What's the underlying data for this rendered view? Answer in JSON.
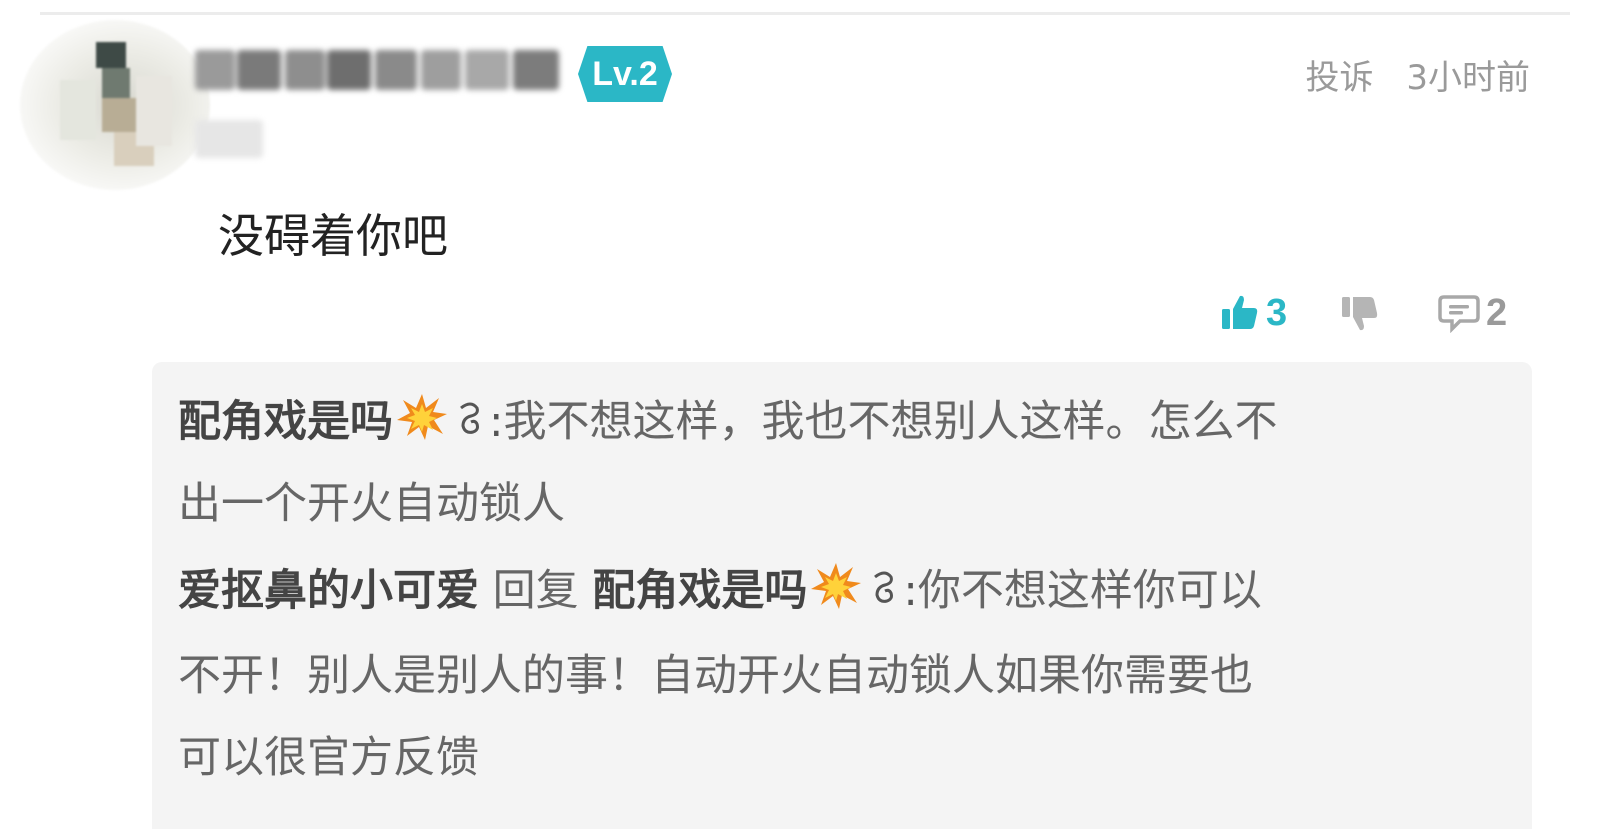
{
  "comment": {
    "level_badge": "Lv.2",
    "report_label": "投诉",
    "time": "3小时前",
    "text": "没碍着你吧",
    "likes": "3",
    "replies_count": "2",
    "accent_color": "#2bb7c6"
  },
  "replies": {
    "r1": {
      "nick": "配角戏是吗",
      "sep": ":",
      "line1": "我不想这样，我也不想别人这样。怎么不",
      "line2": "出一个开火自动锁人"
    },
    "r2": {
      "nick": "爱抠鼻的小可爱",
      "reply_word": "回复",
      "target": "配角戏是吗",
      "sep": ":",
      "line1": "你不想这样你可以",
      "line2": "不开！别人是别人的事！自动开火自动锁人如果你需要也",
      "line3": "可以很官方反馈"
    }
  }
}
